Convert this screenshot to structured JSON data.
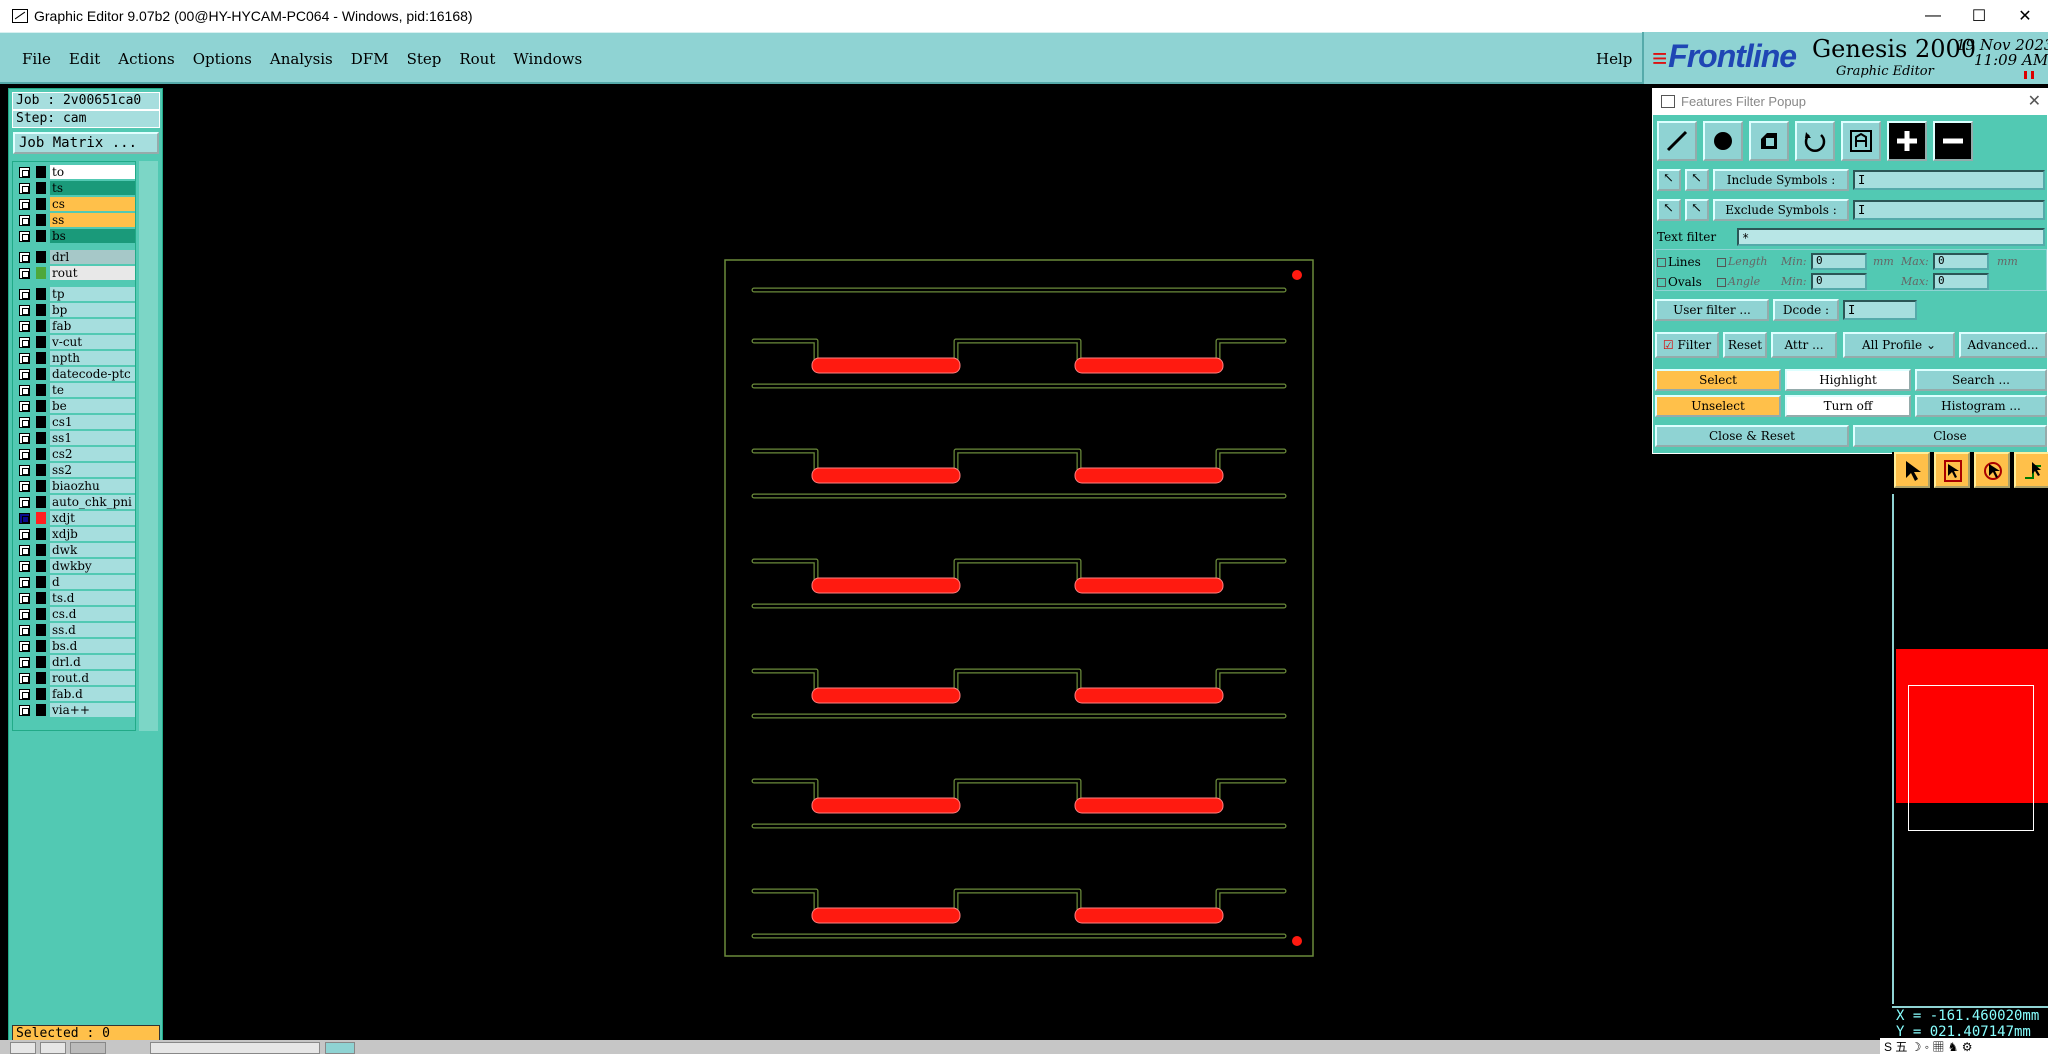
{
  "window": {
    "title": "Graphic Editor 9.07b2 (00@HY-HYCAM-PC064 - Windows, pid:16168)",
    "minimize": "—",
    "maximize": "☐",
    "close": "✕"
  },
  "menubar": {
    "items": [
      "File",
      "Edit",
      "Actions",
      "Options",
      "Analysis",
      "DFM",
      "Step",
      "Rout",
      "Windows"
    ],
    "help": "Help"
  },
  "logo": {
    "brand": "Frontline",
    "product": "Genesis 2000",
    "subtitle": "Graphic Editor",
    "date": "19 Nov 2023",
    "time": "11:09 AM"
  },
  "left_panel": {
    "job": "Job : 2v00651ca0",
    "step": "Step: cam",
    "matrix_button": "Job Matrix ...",
    "selected": "Selected : 0",
    "layers": [
      {
        "name": "to",
        "color": "#ffffff",
        "swatch": "#000000"
      },
      {
        "name": "ts",
        "color": "#1a9a7a",
        "swatch": "#000000"
      },
      {
        "name": "cs",
        "color": "#ffc04a",
        "swatch": "#000000"
      },
      {
        "name": "ss",
        "color": "#ffc04a",
        "swatch": "#000000"
      },
      {
        "name": "bs",
        "color": "#1a9a7a",
        "swatch": "#000000"
      },
      {
        "name": "drl",
        "color": "#a6c8c8",
        "swatch": "#000000"
      },
      {
        "name": "rout",
        "color": "#e8e8e8",
        "swatch": "#4ea83a"
      },
      {
        "name": "tp",
        "color": "#a6dede",
        "swatch": "#000000"
      },
      {
        "name": "bp",
        "color": "#a6dede",
        "swatch": "#000000"
      },
      {
        "name": "fab",
        "color": "#a6dede",
        "swatch": "#000000"
      },
      {
        "name": "v-cut",
        "color": "#a6dede",
        "swatch": "#000000"
      },
      {
        "name": "npth",
        "color": "#a6dede",
        "swatch": "#000000"
      },
      {
        "name": "datecode-ptc",
        "color": "#a6dede",
        "swatch": "#000000"
      },
      {
        "name": "te",
        "color": "#a6dede",
        "swatch": "#000000"
      },
      {
        "name": "be",
        "color": "#a6dede",
        "swatch": "#000000"
      },
      {
        "name": "cs1",
        "color": "#a6dede",
        "swatch": "#000000"
      },
      {
        "name": "ss1",
        "color": "#a6dede",
        "swatch": "#000000"
      },
      {
        "name": "cs2",
        "color": "#a6dede",
        "swatch": "#000000"
      },
      {
        "name": "ss2",
        "color": "#a6dede",
        "swatch": "#000000"
      },
      {
        "name": "biaozhu",
        "color": "#a6dede",
        "swatch": "#000000"
      },
      {
        "name": "auto_chk_pni",
        "color": "#a6dede",
        "swatch": "#000000"
      },
      {
        "name": "xdjt",
        "color": "#a6dede",
        "swatch": "#ff2020",
        "active": true
      },
      {
        "name": "xdjb",
        "color": "#a6dede",
        "swatch": "#000000"
      },
      {
        "name": "dwk",
        "color": "#a6dede",
        "swatch": "#000000"
      },
      {
        "name": "dwkby",
        "color": "#a6dede",
        "swatch": "#000000"
      },
      {
        "name": "d",
        "color": "#a6dede",
        "swatch": "#000000"
      },
      {
        "name": "ts.d",
        "color": "#a6dede",
        "swatch": "#000000"
      },
      {
        "name": "cs.d",
        "color": "#a6dede",
        "swatch": "#000000"
      },
      {
        "name": "ss.d",
        "color": "#a6dede",
        "swatch": "#000000"
      },
      {
        "name": "bs.d",
        "color": "#a6dede",
        "swatch": "#000000"
      },
      {
        "name": "drl.d",
        "color": "#a6dede",
        "swatch": "#000000"
      },
      {
        "name": "rout.d",
        "color": "#a6dede",
        "swatch": "#000000"
      },
      {
        "name": "fab.d",
        "color": "#a6dede",
        "swatch": "#000000"
      },
      {
        "name": "via++",
        "color": "#a6dede",
        "swatch": "#000000"
      }
    ]
  },
  "popup": {
    "title": "Features Filter Popup",
    "include_symbols_label": "Include Symbols :",
    "exclude_symbols_label": "Exclude Symbols :",
    "include_value": "I",
    "exclude_value": "I",
    "text_filter_label": "Text filter",
    "text_filter_value": "*",
    "lines_label": "Lines",
    "ovals_label": "Ovals",
    "length_label": "Length",
    "angle_label": "Angle",
    "min_label": "Min:",
    "max_label": "Max:",
    "length_min": "0",
    "length_max": "0",
    "angle_min": "0",
    "angle_max": "0",
    "unit_mm": "mm",
    "user_filter_label": "User filter ...",
    "dcode_label": "Dcode :",
    "dcode_value": "I",
    "filter_label": "Filter",
    "reset_label": "Reset",
    "attr_label": "Attr ...",
    "profile_label": "All Profile",
    "advanced_label": "Advanced...",
    "select_label": "Select",
    "highlight_label": "Highlight",
    "search_label": "Search ...",
    "unselect_label": "Unselect",
    "turnoff_label": "Turn off",
    "histogram_label": "Histogram ...",
    "close_reset_label": "Close & Reset",
    "close_label": "Close"
  },
  "coords": {
    "x": "X = -161.460020mm",
    "y": "Y = 021.407147mm"
  },
  "tray": {
    "ime": "S 五 ☽ ◦ ▦ ♞ ⚙"
  },
  "colors": {
    "panel": "#52c9b3",
    "menu": "#8fd3d3",
    "pad_red": "#ff1a10",
    "outline_green": "#6a8a3a"
  }
}
